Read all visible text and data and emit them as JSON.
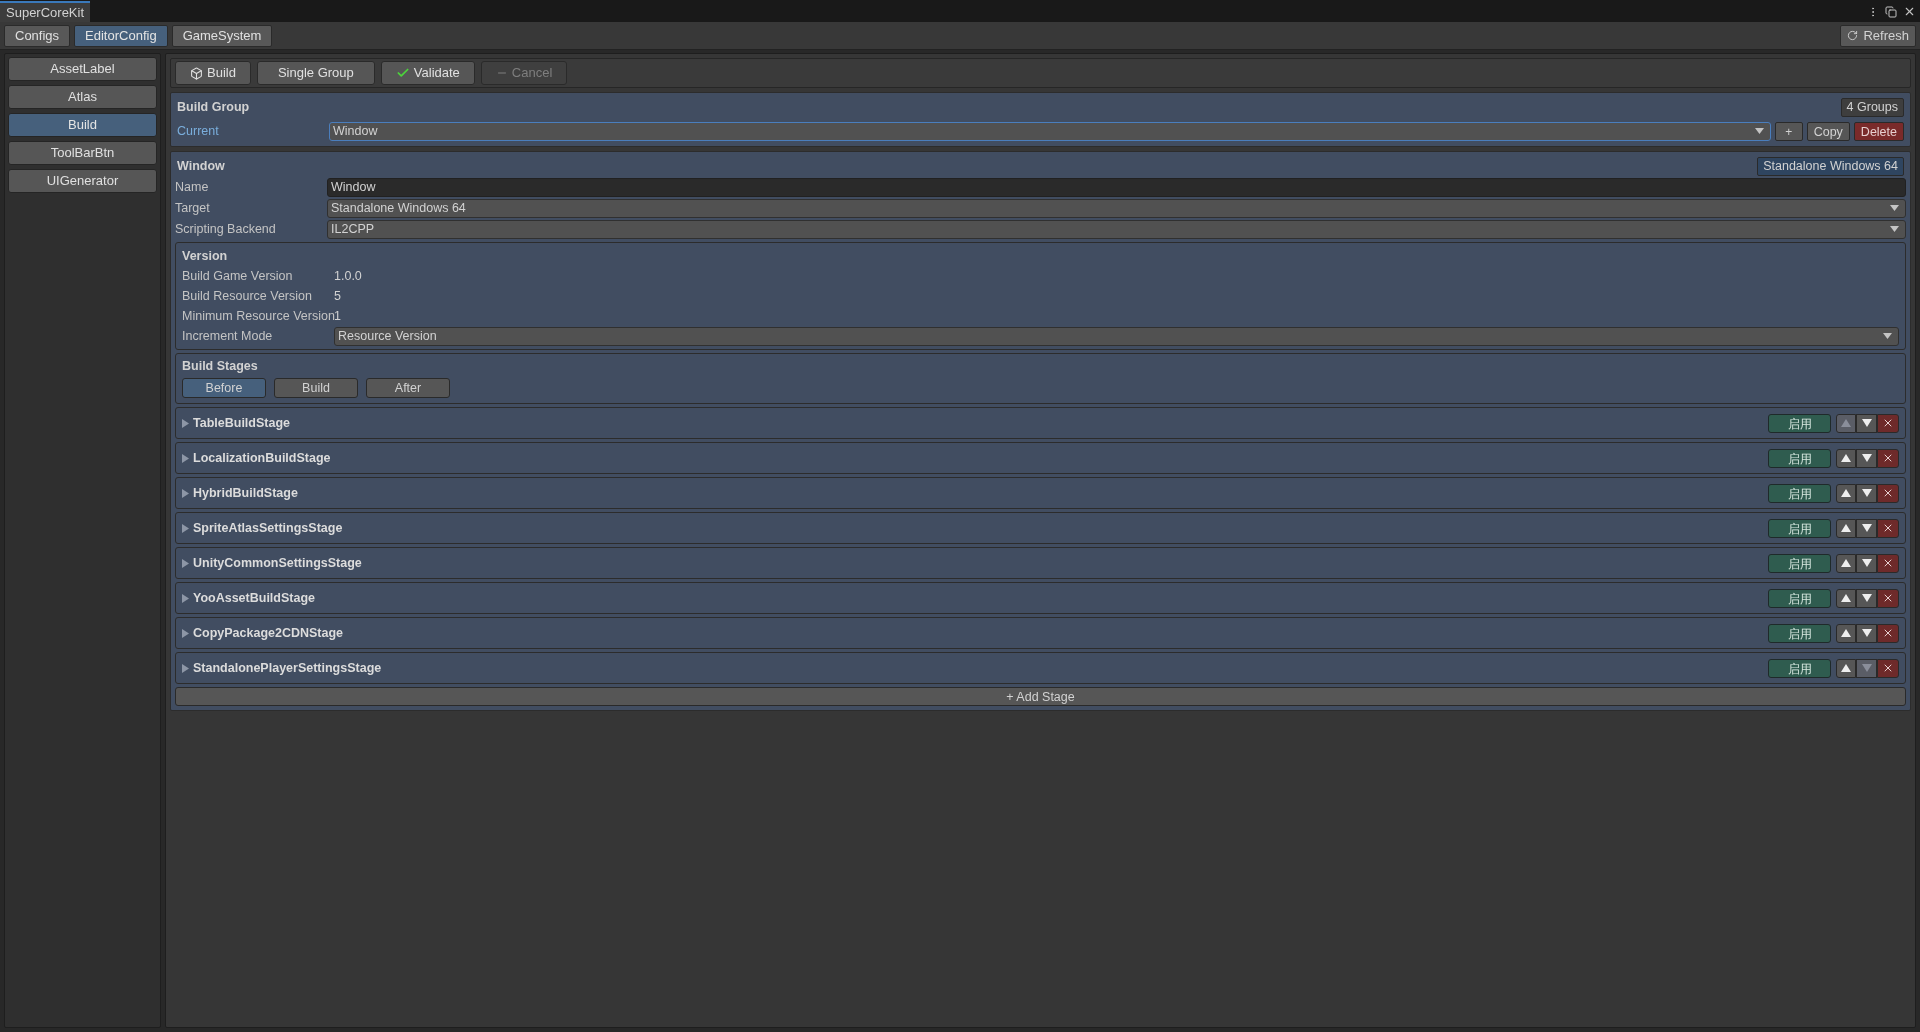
{
  "window": {
    "title": "SuperCoreKit",
    "refresh": "Refresh"
  },
  "tabs": [
    {
      "label": "Configs",
      "selected": false
    },
    {
      "label": "EditorConfig",
      "selected": true
    },
    {
      "label": "GameSystem",
      "selected": false
    }
  ],
  "sidebar": {
    "items": [
      {
        "label": "AssetLabel",
        "selected": false
      },
      {
        "label": "Atlas",
        "selected": false
      },
      {
        "label": "Build",
        "selected": true
      },
      {
        "label": "ToolBarBtn",
        "selected": false
      },
      {
        "label": "UIGenerator",
        "selected": false
      }
    ]
  },
  "toolbar": [
    {
      "kind": "build",
      "label": "Build",
      "disabled": false
    },
    {
      "kind": "plain",
      "label": "Single Group",
      "disabled": false
    },
    {
      "kind": "validate",
      "label": "Validate",
      "disabled": false
    },
    {
      "kind": "cancel",
      "label": "Cancel",
      "disabled": true
    }
  ],
  "build_group": {
    "title": "Build Group",
    "count": "4 Groups",
    "current_label": "Current",
    "current_value": "Window",
    "add": "+",
    "copy": "Copy",
    "delete": "Delete"
  },
  "group": {
    "title": "Window",
    "target_badge": "Standalone Windows 64",
    "fields": [
      {
        "kind": "text",
        "label": "Name",
        "value": "Window"
      },
      {
        "kind": "dropdown",
        "label": "Target",
        "value": "Standalone Windows 64"
      },
      {
        "kind": "dropdown",
        "label": "Scripting Backend",
        "value": "IL2CPP"
      }
    ],
    "version": {
      "title": "Version",
      "fields": [
        {
          "kind": "readout",
          "label": "Build Game Version",
          "value": "1.0.0"
        },
        {
          "kind": "readout",
          "label": "Build Resource Version",
          "value": "5"
        },
        {
          "kind": "readout",
          "label": "Minimum Resource Version",
          "value": "1"
        },
        {
          "kind": "dropdown",
          "label": "Increment Mode",
          "value": "Resource Version"
        }
      ]
    },
    "stages": {
      "title": "Build Stages",
      "tabs": [
        {
          "label": "Before",
          "selected": true
        },
        {
          "label": "Build",
          "selected": false
        },
        {
          "label": "After",
          "selected": false
        }
      ],
      "items": [
        {
          "name": "TableBuildStage",
          "toggle": "启用",
          "up_disabled": true,
          "down_disabled": false
        },
        {
          "name": "LocalizationBuildStage",
          "toggle": "启用",
          "up_disabled": false,
          "down_disabled": false
        },
        {
          "name": "HybridBuildStage",
          "toggle": "启用",
          "up_disabled": false,
          "down_disabled": false
        },
        {
          "name": "SpriteAtlasSettingsStage",
          "toggle": "启用",
          "up_disabled": false,
          "down_disabled": false
        },
        {
          "name": "UnityCommonSettingsStage",
          "toggle": "启用",
          "up_disabled": false,
          "down_disabled": false
        },
        {
          "name": "YooAssetBuildStage",
          "toggle": "启用",
          "up_disabled": false,
          "down_disabled": false
        },
        {
          "name": "CopyPackage2CDNStage",
          "toggle": "启用",
          "up_disabled": false,
          "down_disabled": false
        },
        {
          "name": "StandalonePlayerSettingsStage",
          "toggle": "启用",
          "up_disabled": false,
          "down_disabled": true
        }
      ],
      "add": "+ Add Stage"
    }
  }
}
